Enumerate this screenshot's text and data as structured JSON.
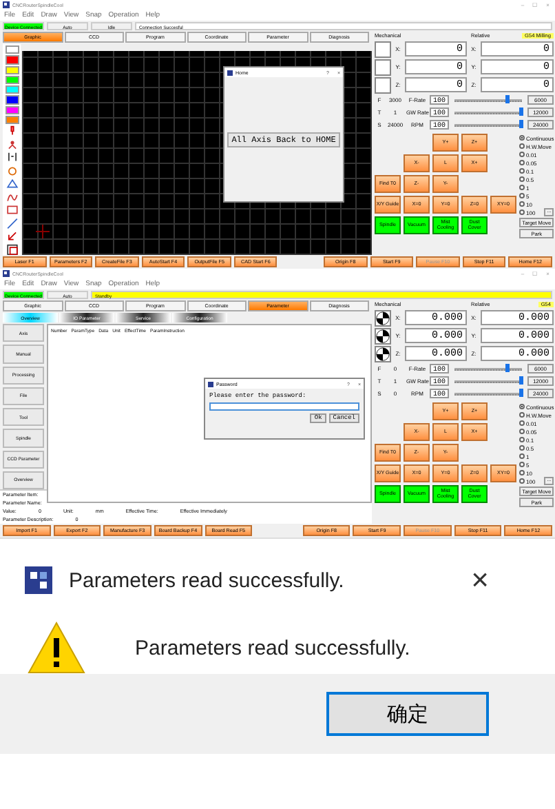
{
  "screens": [
    {
      "kind": "graphic",
      "title": "CNCRouterSpindleCool",
      "window_controls": [
        "–",
        "☐",
        "×"
      ],
      "menu": [
        "File",
        "Edit",
        "Draw",
        "View",
        "Snap",
        "Operation",
        "Help"
      ],
      "status": [
        {
          "text": "Device Connected",
          "color": "#00ff00"
        },
        {
          "text": "Auto",
          "color": "#f0f0f0"
        },
        {
          "text": "Idle",
          "color": "#f0f0f0"
        },
        {
          "text": "Connection Succesful",
          "color": "#ffffff"
        }
      ],
      "tabs": [
        {
          "label": "Graphic",
          "selected": true
        },
        {
          "label": "CCD",
          "selected": false
        },
        {
          "label": "Program",
          "selected": false
        },
        {
          "label": "Coordinate",
          "selected": false
        },
        {
          "label": "Parameter",
          "selected": false
        },
        {
          "label": "Diagnosis",
          "selected": false
        }
      ],
      "swatches": [
        {
          "color": "#ffffff"
        },
        {
          "color": "#ff0000"
        },
        {
          "color": "#ffff00"
        },
        {
          "color": "#00ff00"
        },
        {
          "color": "#00ffff"
        },
        {
          "color": "#0000ff"
        },
        {
          "color": "#ff00ff"
        },
        {
          "color": "#ff8000"
        }
      ],
      "dialog": {
        "title": "Home",
        "controls": [
          "?",
          "×"
        ],
        "button": "All Axis Back to HOME"
      },
      "machine": {
        "headers": [
          "Mechanical",
          "Relative"
        ],
        "coordinate": "G54 Milling",
        "axes": [
          {
            "label": "X:",
            "homed": false,
            "mechanical": "0",
            "relative_label": "X:",
            "relative": "0"
          },
          {
            "label": "Y:",
            "homed": false,
            "mechanical": "0",
            "relative_label": "Y:",
            "relative": "0"
          },
          {
            "label": "Z:",
            "homed": false,
            "mechanical": "0",
            "relative_label": "Z:",
            "relative": "0"
          }
        ],
        "feeds": [
          {
            "letter": "F",
            "value": "3000",
            "label": "F-Rate",
            "percent": "100",
            "level": 0.8,
            "limit": "6000"
          },
          {
            "letter": "T",
            "value": "1",
            "label": "GW Rate",
            "percent": "100",
            "level": 1,
            "limit": "12000"
          },
          {
            "letter": "S",
            "value": "24000",
            "label": "RPM",
            "percent": "100",
            "level": 1,
            "limit": "24000"
          }
        ],
        "jog": [
          "Y+",
          "Z+",
          "X-",
          "L",
          "X+",
          "Find T0",
          "Z-",
          "Y-",
          "X/Y Guide",
          "X=0",
          "Y=0",
          "Z=0",
          "XY=0"
        ],
        "outputs": [
          {
            "label": "Spindle",
            "on": true
          },
          {
            "label": "Vacuum",
            "on": true
          },
          {
            "label": "Mist Cooling",
            "on": true
          },
          {
            "label": "Dust Cover",
            "on": true
          }
        ],
        "steps": [
          {
            "label": "Continuous",
            "selected": true
          },
          {
            "label": "H.W.Move",
            "selected": false
          },
          {
            "label": "0.01",
            "selected": false
          },
          {
            "label": "0.05",
            "selected": false
          },
          {
            "label": "0.1",
            "selected": false
          },
          {
            "label": "0.5",
            "selected": false
          },
          {
            "label": "1",
            "selected": false
          },
          {
            "label": "5",
            "selected": false
          },
          {
            "label": "10",
            "selected": false
          },
          {
            "label": "100",
            "selected": false
          }
        ],
        "step_more": "...",
        "buttons": [
          "Target Move",
          "Park"
        ]
      },
      "function_keys": [
        {
          "kind": "key",
          "label": "Laser F1",
          "disabled": false
        },
        {
          "kind": "key",
          "label": "Parameters F2",
          "disabled": false
        },
        {
          "kind": "key",
          "label": "CreateFile F3",
          "disabled": false
        },
        {
          "kind": "key",
          "label": "AutoStart F4",
          "disabled": false
        },
        {
          "kind": "key",
          "label": "OutputFile F5",
          "disabled": false
        },
        {
          "kind": "key",
          "label": "CAD Start F6",
          "disabled": false
        },
        {
          "kind": "spacer"
        },
        {
          "kind": "key",
          "label": "Origin F8",
          "disabled": false
        },
        {
          "kind": "key",
          "label": "Start F9",
          "disabled": false
        },
        {
          "kind": "key",
          "label": "Pause F10",
          "disabled": true
        },
        {
          "kind": "key",
          "label": "Stop F11",
          "disabled": false
        },
        {
          "kind": "key",
          "label": "Home F12",
          "disabled": false
        }
      ]
    },
    {
      "kind": "parameter",
      "title": "CNCRouterSpindleCool",
      "window_controls": [
        "–",
        "☐",
        "×"
      ],
      "menu": [
        "File",
        "Edit",
        "Draw",
        "View",
        "Snap",
        "Operation",
        "Help"
      ],
      "status": [
        {
          "text": "Device Connected",
          "color": "#00ff00"
        },
        {
          "text": "Auto",
          "color": "#f0f0f0"
        },
        {
          "text": "Standby",
          "color": "#ffff00"
        }
      ],
      "tabs": [
        {
          "label": "Graphic",
          "selected": false
        },
        {
          "label": "CCD",
          "selected": false
        },
        {
          "label": "Program",
          "selected": false
        },
        {
          "label": "Coordinate",
          "selected": false
        },
        {
          "label": "Parameter",
          "selected": true
        },
        {
          "label": "Diagnosis",
          "selected": false
        }
      ],
      "subtabs": [
        {
          "label": "Overview",
          "selected": true
        },
        {
          "label": "IO Parameter",
          "selected": false
        },
        {
          "label": "Service",
          "selected": false
        },
        {
          "label": "Configuration",
          "selected": false
        }
      ],
      "side_buttons": [
        "Axis",
        "Manual",
        "Processing",
        "File",
        "Tool",
        "Spindle",
        "CCD Parameter",
        "Overview"
      ],
      "columns": [
        "Number",
        "ParamType",
        "Data",
        "Unit",
        "EffectTime",
        "ParamInstruction"
      ],
      "info": [
        [
          {
            "label": "Parameter Item:"
          }
        ],
        [
          {
            "label": "Parameter Name:"
          }
        ],
        [
          {
            "label": "Value:",
            "value": "0"
          },
          {
            "label": "Unit:",
            "value": "mm"
          },
          {
            "label": "Effective Time:",
            "value": "Effective Immediately"
          }
        ],
        [
          {
            "label": "Parameter Description:",
            "value": "0"
          }
        ]
      ],
      "dialog": {
        "title": "Password",
        "controls": [
          "?",
          "×"
        ],
        "prompt": "Please enter the password:",
        "buttons": [
          "Ok",
          "Cancel"
        ]
      },
      "machine": {
        "headers": [
          "Mechanical",
          "Relative"
        ],
        "coordinate": "G54",
        "axes": [
          {
            "label": "X:",
            "homed": true,
            "mechanical": "0.000",
            "relative_label": "X:",
            "relative": "0.000"
          },
          {
            "label": "Y:",
            "homed": true,
            "mechanical": "0.000",
            "relative_label": "Y:",
            "relative": "0.000"
          },
          {
            "label": "Z:",
            "homed": true,
            "mechanical": "0.000",
            "relative_label": "Z:",
            "relative": "0.000"
          }
        ],
        "feeds": [
          {
            "letter": "F",
            "value": "0",
            "label": "F-Rate",
            "percent": "100",
            "level": 0.8,
            "limit": "6000"
          },
          {
            "letter": "T",
            "value": "1",
            "label": "GW Rate",
            "percent": "100",
            "level": 1,
            "limit": "12000"
          },
          {
            "letter": "S",
            "value": "0",
            "label": "RPM",
            "percent": "100",
            "level": 1,
            "limit": "24000"
          }
        ],
        "jog": [
          "Y+",
          "Z+",
          "X-",
          "L",
          "X+",
          "Find T0",
          "Z-",
          "Y-",
          "X/Y Guide",
          "X=0",
          "Y=0",
          "Z=0",
          "XY=0"
        ],
        "outputs": [
          {
            "label": "Spindle",
            "on": true
          },
          {
            "label": "Vacuum",
            "on": true
          },
          {
            "label": "Mist Cooling",
            "on": true
          },
          {
            "label": "Dust Cover",
            "on": true
          }
        ],
        "steps": [
          {
            "label": "Continuous",
            "selected": true
          },
          {
            "label": "H.W.Move",
            "selected": false
          },
          {
            "label": "0.01",
            "selected": false
          },
          {
            "label": "0.05",
            "selected": false
          },
          {
            "label": "0.1",
            "selected": false
          },
          {
            "label": "0.5",
            "selected": false
          },
          {
            "label": "1",
            "selected": false
          },
          {
            "label": "5",
            "selected": false
          },
          {
            "label": "10",
            "selected": false
          },
          {
            "label": "100",
            "selected": false
          }
        ],
        "step_more": "...",
        "buttons": [
          "Target Move",
          "Park"
        ]
      },
      "function_keys": [
        {
          "kind": "key",
          "label": "Import F1",
          "disabled": false
        },
        {
          "kind": "key",
          "label": "Export F2",
          "disabled": false
        },
        {
          "kind": "key",
          "label": "Manufacture F3",
          "disabled": false
        },
        {
          "kind": "key",
          "label": "Board Backup F4",
          "disabled": false
        },
        {
          "kind": "key",
          "label": "Board Read F5",
          "disabled": false
        },
        {
          "kind": "spacer"
        },
        {
          "kind": "key",
          "label": "Origin F8",
          "disabled": false
        },
        {
          "kind": "key",
          "label": "Start F9",
          "disabled": false
        },
        {
          "kind": "key",
          "label": "Pause F10",
          "disabled": true
        },
        {
          "kind": "key",
          "label": "Stop F11",
          "disabled": false
        },
        {
          "kind": "key",
          "label": "Home F12",
          "disabled": false
        }
      ]
    }
  ],
  "message_box": {
    "title": "Parameters read successfully.",
    "close": "×",
    "message": "Parameters read successfully.",
    "button": "确定"
  }
}
